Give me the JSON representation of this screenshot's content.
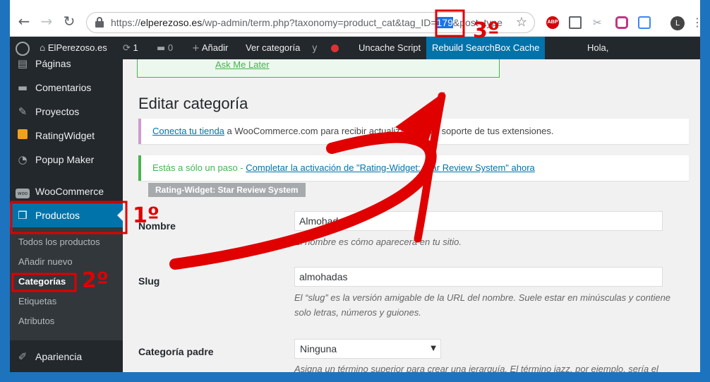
{
  "browser": {
    "url_host": "elperezoso.es",
    "url_prefix": "https://",
    "url_path_before": "/wp-admin/term.php?taxonomy=product_cat&tag_ID=",
    "url_selected": "179",
    "url_after": "&post_type",
    "profile_initial": "L",
    "abp_label": "ABP"
  },
  "adminbar": {
    "site_name": "ElPerezoso.es",
    "updates_count": "1",
    "comments_count": "0",
    "add_new": "Añadir",
    "view_category": "Ver categoría",
    "uncache": "Uncache Script",
    "rebuild": "Rebuild SearchBox Cache",
    "greeting": "Hola,"
  },
  "sidebar": {
    "items": [
      {
        "label": "Páginas"
      },
      {
        "label": "Comentarios"
      },
      {
        "label": "Proyectos"
      },
      {
        "label": "RatingWidget"
      },
      {
        "label": "Popup Maker"
      },
      {
        "label": "WooCommerce"
      },
      {
        "label": "Productos"
      },
      {
        "label": "Apariencia"
      }
    ],
    "woo_icon_text": "woo",
    "submenu": [
      {
        "label": "Todos los productos"
      },
      {
        "label": "Añadir nuevo"
      },
      {
        "label": "Categorías"
      },
      {
        "label": "Etiquetas"
      },
      {
        "label": "Atributos"
      }
    ]
  },
  "main": {
    "ask_later": "Ask Me Later",
    "title": "Editar categoría",
    "notice1": {
      "link": "Conecta tu tienda",
      "text": " a WooCommerce.com para recibir actualizaciones y soporte de tus extensiones."
    },
    "notice2": {
      "lead": "Estás a sólo un paso - ",
      "link": "Completar la activación de \"Rating-Widget: Star Review System\" ahora"
    },
    "plugin_tag": "Rating-Widget: Star Review System",
    "name_label": "Nombre",
    "name_value": "Almohadas",
    "name_desc": "El nombre es cómo aparecerá en tu sitio.",
    "slug_label": "Slug",
    "slug_value": "almohadas",
    "slug_desc": "El “slug” es la versión amigable de la URL del nombre. Suele estar en minúsculas y contiene solo letras, números y guiones.",
    "parent_label": "Categoría padre",
    "parent_value": "Ninguna",
    "parent_desc": "Asigna un término superior para crear una jerarquía. El término jazz, por ejemplo, sería el"
  },
  "annotations": {
    "step1": "1º",
    "step2": "2º",
    "step3": "3º",
    "color": "#e00000"
  },
  "colors": {
    "wp_dark": "#23282d",
    "wp_blue": "#0073aa",
    "frame_blue": "#1e73be",
    "notice_green": "#46b450"
  }
}
